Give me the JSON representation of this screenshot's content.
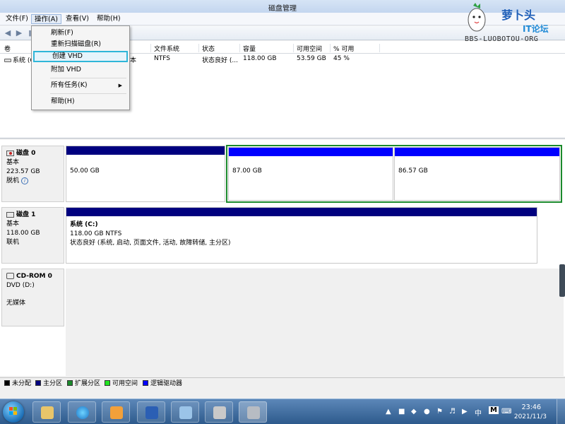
{
  "window": {
    "title": "磁盘管理"
  },
  "menubar": {
    "items": [
      "文件(F)",
      "操作(A)",
      "查看(V)",
      "帮助(H)"
    ]
  },
  "action_menu": {
    "items": [
      "刷新(F)",
      "重新扫描磁盘(R)",
      "创建 VHD",
      "附加 VHD",
      "所有任务(K)",
      "帮助(H)"
    ],
    "highlighted": "创建 VHD"
  },
  "volume_list": {
    "headers": [
      "卷",
      "文件系统",
      "状态",
      "容量",
      "可用空间",
      "% 可用"
    ],
    "rows": [
      {
        "volume": "系统 (C:)",
        "type_partial": "本",
        "fs": "NTFS",
        "status": "状态良好 (...",
        "capacity": "118.00 GB",
        "free": "53.59 GB",
        "percent": "45 %"
      }
    ]
  },
  "disks": [
    {
      "name": "磁盘 0",
      "type": "基本",
      "size": "223.57 GB",
      "state": "脱机",
      "partitions": [
        {
          "size": "50.00 GB",
          "bar_color": "#00007f"
        },
        {
          "size": "87.00 GB",
          "bar_color": "#0000ff"
        },
        {
          "size": "86.57 GB",
          "bar_color": "#0000ff"
        }
      ]
    },
    {
      "name": "磁盘 1",
      "type": "基本",
      "size": "118.00 GB",
      "state": "联机",
      "partitions": [
        {
          "label": "系统  (C:)",
          "detail": "118.00 GB NTFS",
          "status": "状态良好 (系统, 启动, 页面文件, 活动, 故障转储, 主分区)",
          "bar_color": "#00007f"
        }
      ]
    },
    {
      "name": "CD-ROM 0",
      "type": "DVD (D:)",
      "state": "无媒体"
    }
  ],
  "legend": [
    {
      "label": "未分配",
      "color": "#000000"
    },
    {
      "label": "主分区",
      "color": "#00007f"
    },
    {
      "label": "扩展分区",
      "color": "#1b8a2c"
    },
    {
      "label": "可用空间",
      "color": "#21e421"
    },
    {
      "label": "逻辑驱动器",
      "color": "#0000ff"
    }
  ],
  "taskbar": {
    "clock_time": "23:46",
    "clock_date": "2021/11/3",
    "ime": "中",
    "ime_mode": "M"
  },
  "watermark": {
    "name": "萝卜头",
    "sub": "IT论坛",
    "url": "BBS-LUOBOTOU-ORG"
  }
}
